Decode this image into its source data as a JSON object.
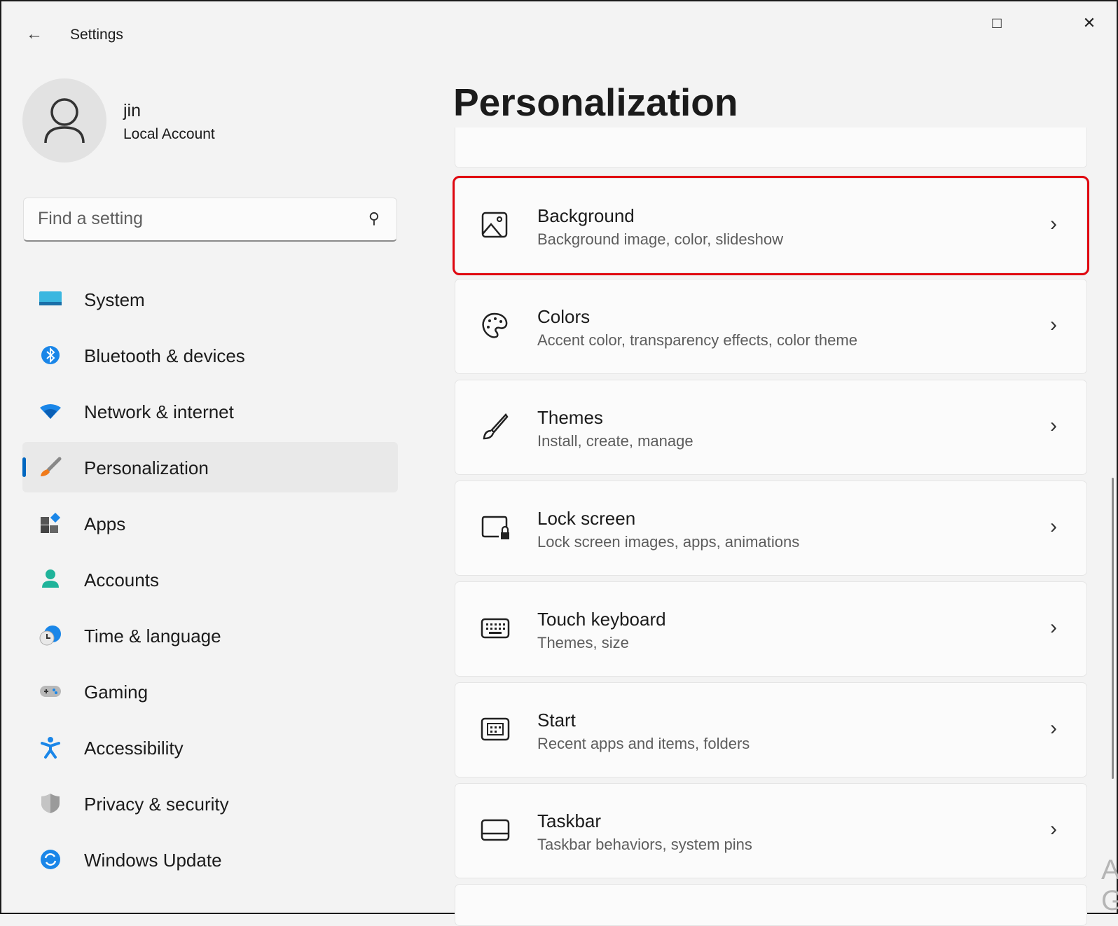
{
  "window": {
    "title": "Settings",
    "back_icon": "back-arrow-icon",
    "minimize_icon": "minimize-icon",
    "maximize_icon": "maximize-icon",
    "close_icon": "close-icon"
  },
  "user": {
    "name": "jin",
    "type": "Local Account"
  },
  "search": {
    "placeholder": "Find a setting",
    "value": ""
  },
  "sidebar": {
    "items": [
      {
        "label": "System",
        "icon": "system-icon"
      },
      {
        "label": "Bluetooth & devices",
        "icon": "bluetooth-icon"
      },
      {
        "label": "Network & internet",
        "icon": "wifi-icon"
      },
      {
        "label": "Personalization",
        "icon": "brush-icon",
        "selected": true
      },
      {
        "label": "Apps",
        "icon": "apps-icon"
      },
      {
        "label": "Accounts",
        "icon": "person-icon"
      },
      {
        "label": "Time & language",
        "icon": "clock-globe-icon"
      },
      {
        "label": "Gaming",
        "icon": "gamepad-icon"
      },
      {
        "label": "Accessibility",
        "icon": "accessibility-icon"
      },
      {
        "label": "Privacy & security",
        "icon": "shield-icon"
      },
      {
        "label": "Windows Update",
        "icon": "update-icon"
      }
    ]
  },
  "main": {
    "title": "Personalization",
    "cards": [
      {
        "title": "Background",
        "desc": "Background image, color, slideshow",
        "icon": "image-icon",
        "highlighted": true
      },
      {
        "title": "Colors",
        "desc": "Accent color, transparency effects, color theme",
        "icon": "palette-icon"
      },
      {
        "title": "Themes",
        "desc": "Install, create, manage",
        "icon": "brush-outline-icon"
      },
      {
        "title": "Lock screen",
        "desc": "Lock screen images, apps, animations",
        "icon": "lock-screen-icon"
      },
      {
        "title": "Touch keyboard",
        "desc": "Themes, size",
        "icon": "keyboard-icon"
      },
      {
        "title": "Start",
        "desc": "Recent apps and items, folders",
        "icon": "start-icon"
      },
      {
        "title": "Taskbar",
        "desc": "Taskbar behaviors, system pins",
        "icon": "taskbar-icon"
      }
    ]
  },
  "colors": {
    "accent": "#0067c0",
    "highlight": "#e0060f"
  },
  "watermark": "A G"
}
